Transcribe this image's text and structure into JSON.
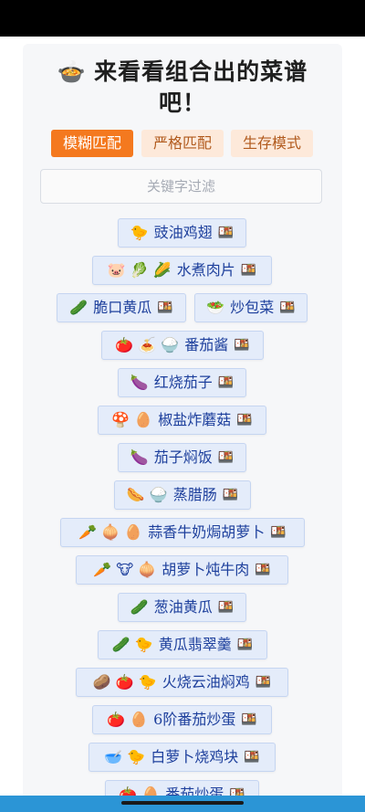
{
  "title": {
    "emoji": "🍲",
    "text": "来看看组合出的菜谱吧！"
  },
  "modes": [
    {
      "label": "模糊匹配",
      "active": true
    },
    {
      "label": "严格匹配",
      "active": false
    },
    {
      "label": "生存模式",
      "active": false
    }
  ],
  "filter": {
    "placeholder": "关键字过滤"
  },
  "pot_icon": "🍱",
  "recipes": [
    {
      "icons": "🐤",
      "name": "豉油鸡翅"
    },
    {
      "icons": "🐷 🥬 🌽",
      "name": "水煮肉片"
    },
    {
      "icons": "🥒",
      "name": "脆口黄瓜"
    },
    {
      "icons": "🥗",
      "name": "炒包菜"
    },
    {
      "icons": "🍅 🍝 🍚",
      "name": "番茄酱"
    },
    {
      "icons": "🍆",
      "name": "红烧茄子"
    },
    {
      "icons": "🍄 🥚",
      "name": "椒盐炸蘑菇"
    },
    {
      "icons": "🍆",
      "name": "茄子焖饭"
    },
    {
      "icons": "🌭 🍚",
      "name": "蒸腊肠"
    },
    {
      "icons": "🥕 🧅 🥚",
      "name": "蒜香牛奶焗胡萝卜"
    },
    {
      "icons": "🥕 🐮 🧅",
      "name": "胡萝卜炖牛肉"
    },
    {
      "icons": "🥒",
      "name": "葱油黄瓜"
    },
    {
      "icons": "🥒 🐤",
      "name": "黄瓜翡翠羹"
    },
    {
      "icons": "🥔 🍅 🐤",
      "name": "火烧云油焖鸡"
    },
    {
      "icons": "🍅 🥚",
      "name": "6阶番茄炒蛋"
    },
    {
      "icons": "🥣 🐤",
      "name": "白萝卜烧鸡块"
    },
    {
      "icons": "🍅 🥚",
      "name": "番茄炒蛋"
    }
  ]
}
